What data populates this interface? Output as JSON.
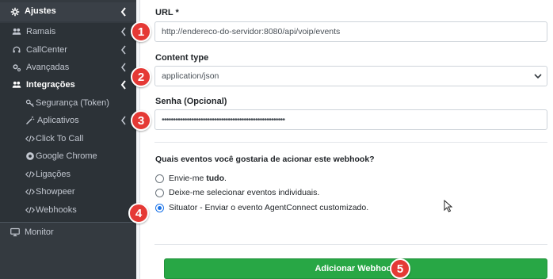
{
  "sidebar": {
    "top": {
      "label": "Ajustes",
      "icon": "gear-icon"
    },
    "items": [
      {
        "label": "Ramais",
        "icon": "users-icon"
      },
      {
        "label": "CallCenter",
        "icon": "headset-icon"
      },
      {
        "label": "Avançadas",
        "icon": "gears-icon"
      },
      {
        "label": "Integrações",
        "icon": "users-icon"
      },
      {
        "label": "Segurança (Token)",
        "icon": "key-icon"
      },
      {
        "label": "Aplicativos",
        "icon": "magic-wand-icon"
      },
      {
        "label": "Click To Call",
        "icon": "code-icon"
      },
      {
        "label": "Google Chrome",
        "icon": "chrome-icon"
      },
      {
        "label": "Ligações",
        "icon": "code-icon"
      },
      {
        "label": "Showpeer",
        "icon": "code-icon"
      },
      {
        "label": "Webhooks",
        "icon": "code-icon"
      }
    ],
    "monitor": {
      "label": "Monitor",
      "icon": "monitor-icon"
    }
  },
  "form": {
    "url_label": "URL *",
    "url_value": "http://endereco-do-servidor:8080/api/voip/events",
    "content_type_label": "Content type",
    "content_type_value": "application/json",
    "password_label": "Senha (Opcional)",
    "password_value": "••••••••••••••••••••••••••••••••••••••••••••••••••••••",
    "question": "Quais eventos você gostaria de acionar este webhook?",
    "options": [
      {
        "prefix": "Envie-me ",
        "bold": "tudo",
        "suffix": ".",
        "checked": false
      },
      {
        "prefix": "Deixe-me selecionar eventos individuais.",
        "bold": "",
        "suffix": "",
        "checked": false
      },
      {
        "prefix": "Situator - Enviar o evento AgentConnect customizado.",
        "bold": "",
        "suffix": "",
        "checked": true
      }
    ],
    "submit_label": "Adicionar Webhook"
  },
  "badges": [
    "1",
    "2",
    "3",
    "4",
    "5"
  ],
  "colors": {
    "sidebar_bg": "#343a40",
    "submit_bg": "#28a745",
    "badge_bg": "#e53935",
    "radio_checked": "#1a73e8"
  }
}
